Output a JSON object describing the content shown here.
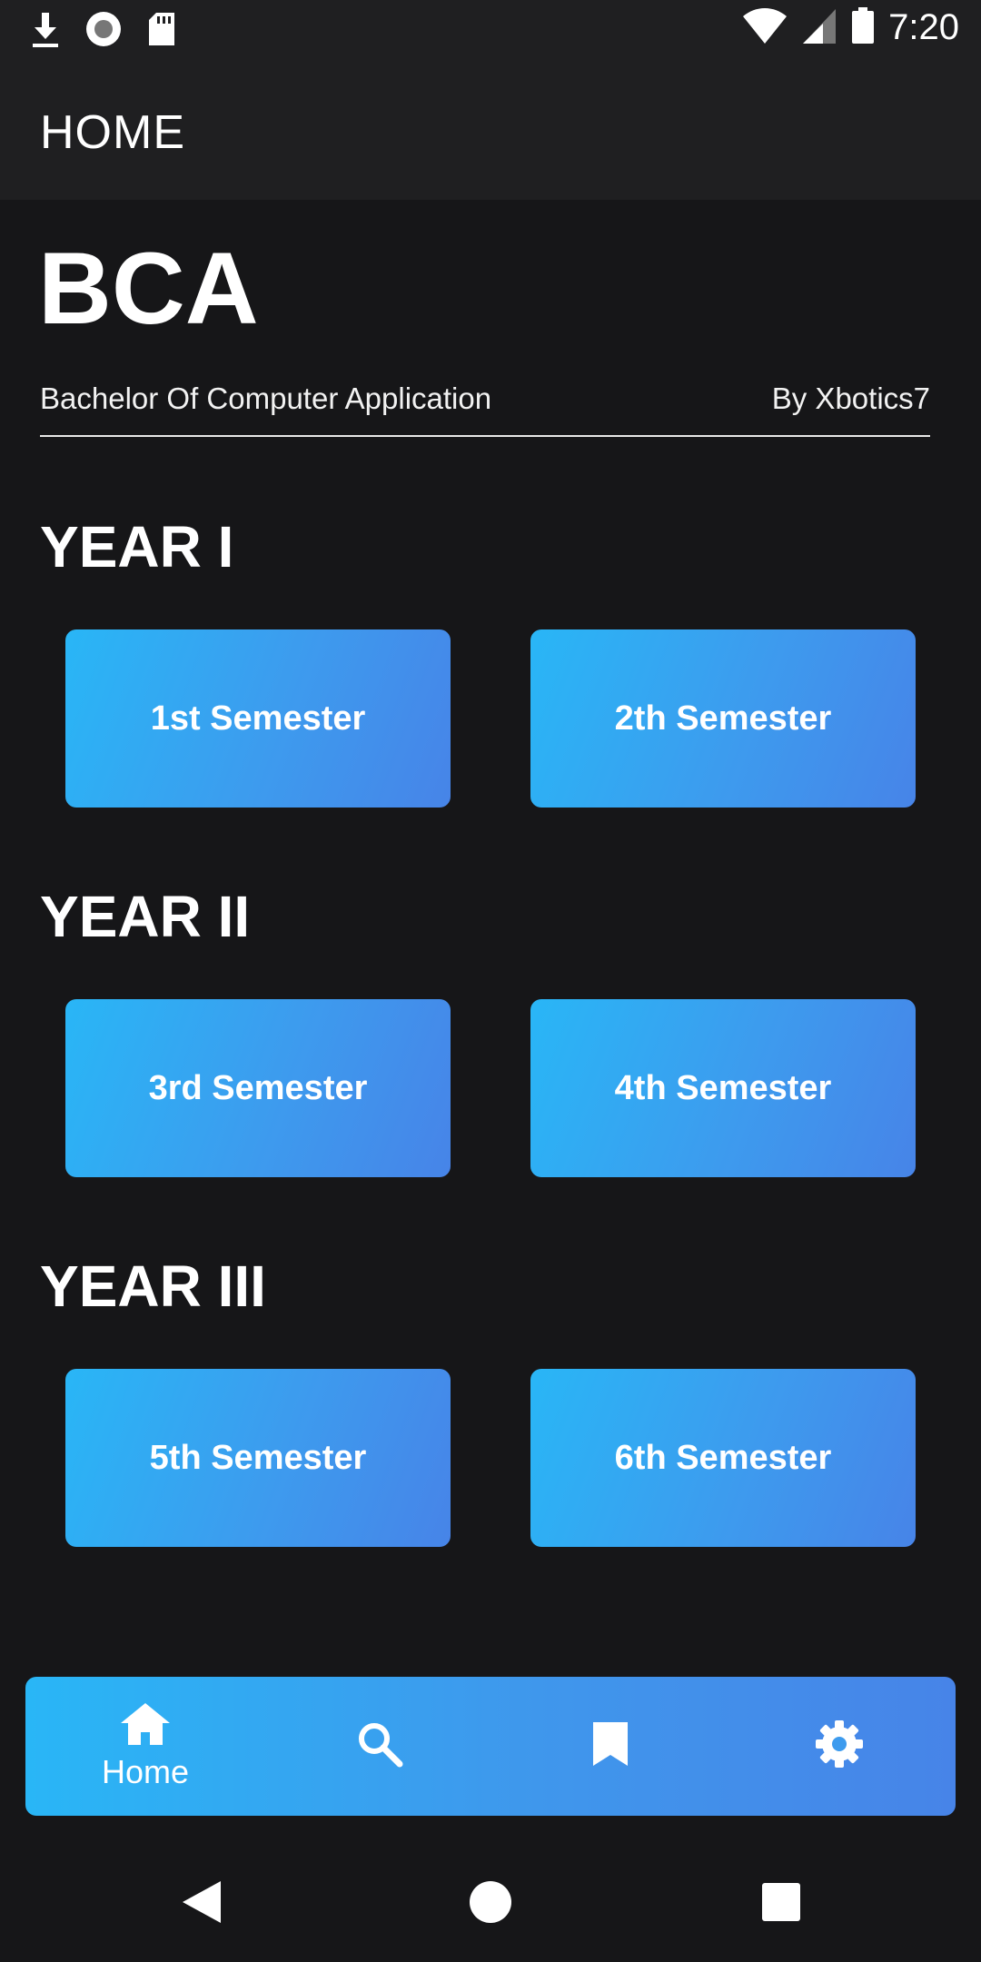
{
  "status_bar": {
    "time": "7:20",
    "icons": [
      "download-icon",
      "record-icon",
      "sd-card-icon",
      "wifi-icon",
      "signal-icon",
      "battery-icon"
    ]
  },
  "app_bar": {
    "title": "HOME"
  },
  "hero": {
    "title": "BCA",
    "subtitle": "Bachelor Of Computer Application",
    "author": "By Xbotics7"
  },
  "years": [
    {
      "label": "YEAR I",
      "semesters": [
        "1st Semester",
        "2th Semester"
      ]
    },
    {
      "label": "YEAR II",
      "semesters": [
        "3rd Semester",
        "4th Semester"
      ]
    },
    {
      "label": "YEAR III",
      "semesters": [
        "5th Semester",
        "6th Semester"
      ]
    }
  ],
  "bottom_nav": {
    "items": [
      {
        "icon": "home-icon",
        "label": "Home",
        "active": true
      },
      {
        "icon": "search-icon",
        "label": ""
      },
      {
        "icon": "bookmark-icon",
        "label": ""
      },
      {
        "icon": "gear-icon",
        "label": ""
      }
    ]
  },
  "system_nav": [
    "back-icon",
    "home-circle-icon",
    "recents-icon"
  ],
  "colors": {
    "background": "#161618",
    "bar": "#1f1f21",
    "gradient_start": "#29b6f6",
    "gradient_end": "#4784e8"
  }
}
